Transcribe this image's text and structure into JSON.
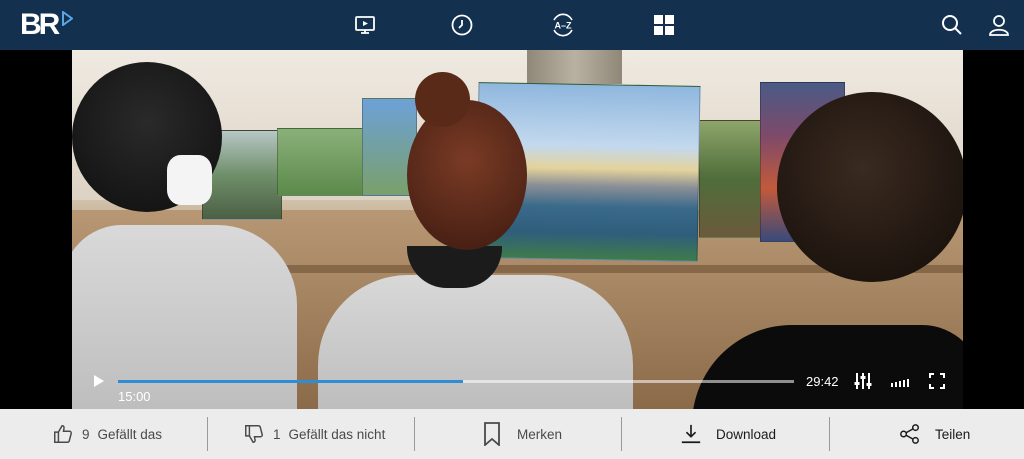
{
  "header": {
    "logo_text": "BR",
    "nav_icons": [
      "tv-play-icon",
      "clock-icon",
      "a-z-icon",
      "grid-icon"
    ],
    "right_icons": [
      "search-icon",
      "user-icon"
    ],
    "brand_color": "#13314f",
    "accent_color": "#2f8dd6"
  },
  "player": {
    "current_time": "15:00",
    "total_time": "29:42",
    "progress": 0.51,
    "icons": [
      "play-icon",
      "settings-sliders-icon",
      "quality-bars-icon",
      "fullscreen-icon"
    ]
  },
  "actions": {
    "like_count": "9",
    "like_label": "Gefällt das",
    "dislike_count": "1",
    "dislike_label": "Gefällt das nicht",
    "bookmark_label": "Merken",
    "download_label": "Download",
    "share_label": "Teilen"
  }
}
